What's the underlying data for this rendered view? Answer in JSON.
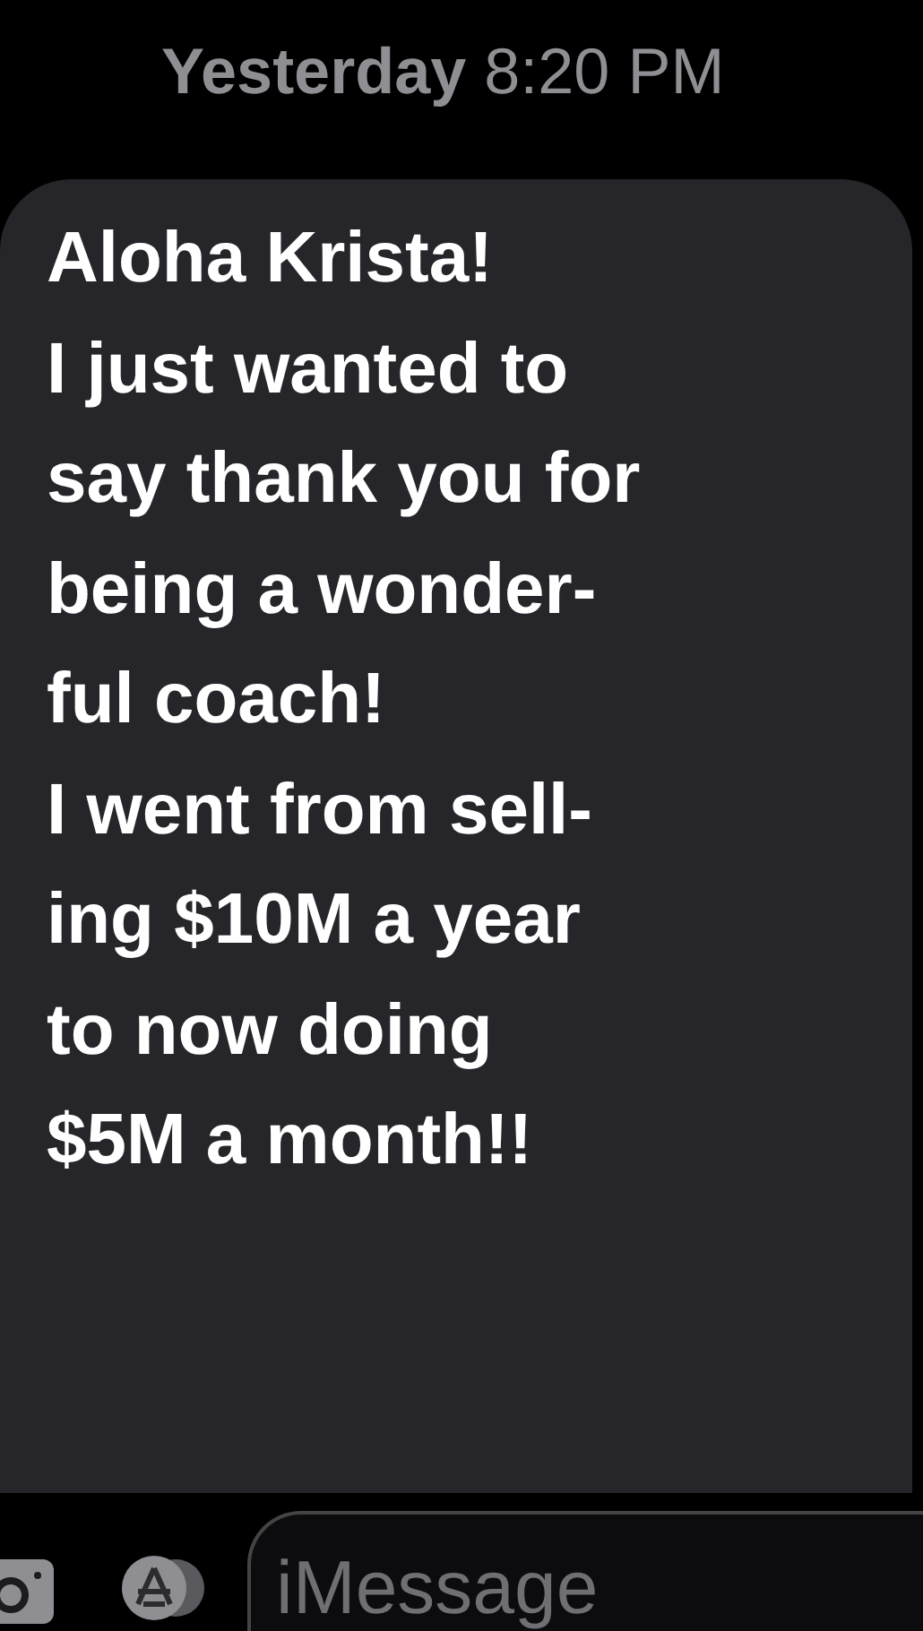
{
  "timestamp": "**Yesterday** 8:20 PM",
  "message": {
    "text": "Aloha Krista!\nI just wanted to\nsay thank you for\nbeing a wonder-\nful coach!\nI went from sell-\ning $10M a year\nto now doing\n$5M a month!!"
  },
  "compose": {
    "placeholder": "iMessage"
  }
}
